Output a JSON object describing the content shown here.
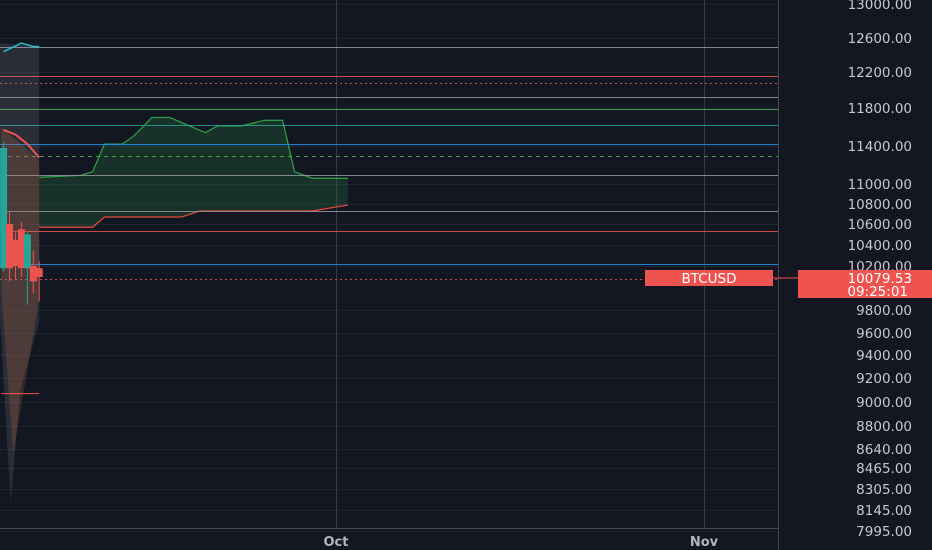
{
  "colors": {
    "background": "#131722",
    "axis_text": "#c5c9d2",
    "grid": "#2a2e39",
    "candle_up": "#26a69a",
    "candle_down": "#ef5350",
    "price_tag": "#ef5350"
  },
  "symbol": {
    "name": "BTCUSD",
    "last_price": "10079.53",
    "countdown": "09:25:01"
  },
  "chart_data": {
    "type": "candlestick",
    "y_axis": {
      "ticks": [
        {
          "value": 13000,
          "label": "13000.00"
        },
        {
          "value": 12600,
          "label": "12600.00"
        },
        {
          "value": 12200,
          "label": "12200.00"
        },
        {
          "value": 11800,
          "label": "11800.00"
        },
        {
          "value": 11400,
          "label": "11400.00"
        },
        {
          "value": 11000,
          "label": "11000.00"
        },
        {
          "value": 10800,
          "label": "10800.00"
        },
        {
          "value": 10600,
          "label": "10600.00"
        },
        {
          "value": 10400,
          "label": "10400.00"
        },
        {
          "value": 10200,
          "label": "10200.00"
        },
        {
          "value": 9800,
          "label": "9800.00"
        },
        {
          "value": 9600,
          "label": "9600.00"
        },
        {
          "value": 9400,
          "label": "9400.00"
        },
        {
          "value": 9200,
          "label": "9200.00"
        },
        {
          "value": 9000,
          "label": "9000.00"
        },
        {
          "value": 8800,
          "label": "8800.00"
        },
        {
          "value": 8640,
          "label": "8640.00"
        },
        {
          "value": 8465,
          "label": "8465.00"
        },
        {
          "value": 8305,
          "label": "8305.00"
        },
        {
          "value": 8145,
          "label": "8145.00"
        },
        {
          "value": 7995,
          "label": "7995.00"
        }
      ]
    },
    "x_axis": {
      "labels": [
        {
          "label": "Oct",
          "day": 30
        },
        {
          "label": "Nov",
          "day": 61
        }
      ],
      "visible_days": [
        2,
        66
      ]
    },
    "candles": [
      {
        "day": 2.0,
        "open": 10180,
        "high": 11440,
        "low": 10150,
        "close": 11380
      },
      {
        "day": 2.5,
        "open": 10600,
        "high": 10720,
        "low": 10060,
        "close": 10180
      },
      {
        "day": 3.0,
        "open": 10450,
        "high": 10520,
        "low": 10080,
        "close": 10200
      },
      {
        "day": 3.5,
        "open": 10550,
        "high": 10620,
        "low": 10100,
        "close": 10180
      },
      {
        "day": 4.0,
        "open": 10180,
        "high": 10520,
        "low": 9850,
        "close": 10500
      },
      {
        "day": 4.5,
        "open": 10200,
        "high": 10350,
        "low": 9950,
        "close": 10060
      },
      {
        "day": 5.0,
        "open": 10180,
        "high": 10250,
        "low": 9880,
        "close": 10100
      }
    ],
    "horizontal_levels": [
      {
        "price": 12500,
        "color": "#9598a1",
        "style": "solid"
      },
      {
        "price": 12160,
        "color": "#ef5350",
        "style": "solid"
      },
      {
        "price": 12080,
        "color": "#ef5350",
        "style": "dotted"
      },
      {
        "price": 11920,
        "color": "#9598a1",
        "style": "solid"
      },
      {
        "price": 11790,
        "color": "#4caf50",
        "style": "solid"
      },
      {
        "price": 11620,
        "color": "#26a69a",
        "style": "solid"
      },
      {
        "price": 11420,
        "color": "#2196f3",
        "style": "solid"
      },
      {
        "price": 11290,
        "color": "#4caf50",
        "style": "dashed"
      },
      {
        "price": 11100,
        "color": "#9598a1",
        "style": "solid"
      },
      {
        "price": 10730,
        "color": "#9598a1",
        "style": "solid"
      },
      {
        "price": 10530,
        "color": "#ef5350",
        "style": "solid"
      },
      {
        "price": 10220,
        "color": "#2196f3",
        "style": "solid"
      },
      {
        "price": 10079.53,
        "color": "#ef5350",
        "style": "dotted"
      }
    ],
    "cloud_upper": [
      {
        "day": 5.0,
        "price": 11070
      },
      {
        "day": 8.5,
        "price": 11090
      },
      {
        "day": 9.5,
        "price": 11130
      },
      {
        "day": 10.5,
        "price": 11420
      },
      {
        "day": 12.0,
        "price": 11420
      },
      {
        "day": 13.0,
        "price": 11510
      },
      {
        "day": 14.5,
        "price": 11700
      },
      {
        "day": 16.0,
        "price": 11700
      },
      {
        "day": 17.5,
        "price": 11620
      },
      {
        "day": 19.0,
        "price": 11540
      },
      {
        "day": 20.0,
        "price": 11610
      },
      {
        "day": 22.0,
        "price": 11610
      },
      {
        "day": 24.0,
        "price": 11670
      },
      {
        "day": 25.5,
        "price": 11670
      },
      {
        "day": 26.5,
        "price": 11130
      },
      {
        "day": 28.0,
        "price": 11060
      },
      {
        "day": 31.0,
        "price": 11060
      }
    ],
    "cloud_lower": [
      {
        "day": 5.0,
        "price": 10570
      },
      {
        "day": 9.5,
        "price": 10570
      },
      {
        "day": 10.5,
        "price": 10670
      },
      {
        "day": 17.0,
        "price": 10670
      },
      {
        "day": 18.5,
        "price": 10730
      },
      {
        "day": 28.0,
        "price": 10730
      },
      {
        "day": 31.0,
        "price": 10790
      }
    ],
    "red_band_line": [
      {
        "day": 2.0,
        "price": 11570
      },
      {
        "day": 3.0,
        "price": 11520
      },
      {
        "day": 4.0,
        "price": 11420
      },
      {
        "day": 5.0,
        "price": 11280
      }
    ],
    "cyan_top_line": [
      {
        "day": 2.0,
        "price": 12440
      },
      {
        "day": 3.5,
        "price": 12540
      },
      {
        "day": 4.5,
        "price": 12500
      },
      {
        "day": 5.0,
        "price": 12500
      }
    ]
  }
}
